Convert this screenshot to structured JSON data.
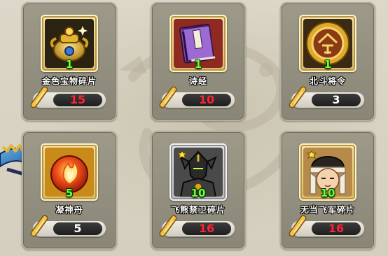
{
  "items": [
    {
      "name": "金色宝物碎片",
      "count": "1",
      "cost": "15",
      "cost_color": "#e8102a",
      "icon": "golden-treasure-icon",
      "frame": "gold"
    },
    {
      "name": "诗经",
      "count": "1",
      "cost": "10",
      "cost_color": "#e8102a",
      "icon": "book-icon",
      "frame": "gold"
    },
    {
      "name": "北斗将令",
      "count": "1",
      "cost": "3",
      "cost_color": "#ffffff",
      "icon": "command-token-icon",
      "frame": "gold"
    },
    {
      "name": "凝神丹",
      "count": "5",
      "cost": "5",
      "cost_color": "#ffffff",
      "icon": "fire-pill-icon",
      "frame": "gold"
    },
    {
      "name": "飞熊禁卫碎片",
      "count": "10",
      "cost": "16",
      "cost_color": "#e8102a",
      "icon": "armored-warrior-icon",
      "frame": "gray"
    },
    {
      "name": "无当飞军碎片",
      "count": "10",
      "cost": "16",
      "cost_color": "#e8102a",
      "icon": "fur-hat-warrior-icon",
      "frame": "gold"
    }
  ],
  "currency_icon": "scroll-currency-icon"
}
